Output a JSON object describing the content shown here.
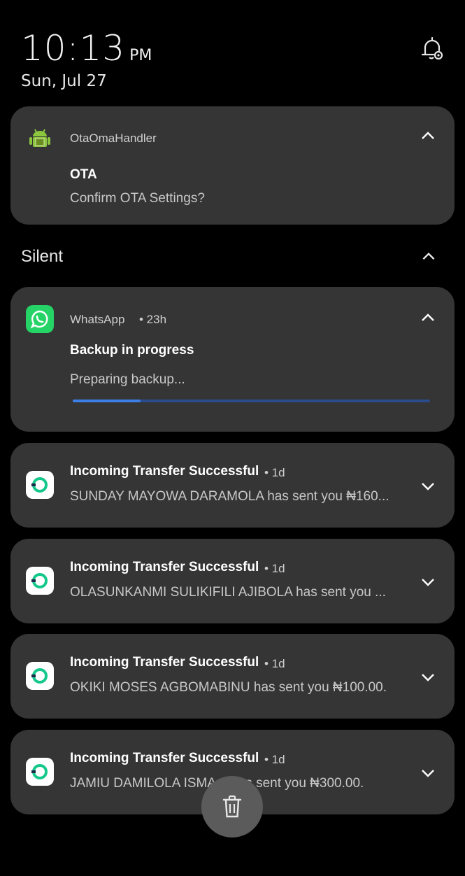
{
  "status": {
    "time": "10:13",
    "ampm": "PM",
    "date": "Sun, Jul 27"
  },
  "ota": {
    "app": "OtaOmaHandler",
    "title": "OTA",
    "body": "Confirm OTA Settings?"
  },
  "section": {
    "label": "Silent"
  },
  "whatsapp": {
    "app": "WhatsApp",
    "time": "• 23h",
    "title": "Backup in progress",
    "body": "Preparing backup...",
    "progress": 0.19,
    "brand_color": "#25d366"
  },
  "transfers": [
    {
      "title": "Incoming Transfer Successful",
      "time": "• 1d",
      "body": "SUNDAY MAYOWA DARAMOLA has sent you ₦160..."
    },
    {
      "title": "Incoming Transfer Successful",
      "time": "• 1d",
      "body": "OLASUNKANMI SULIKIFILI AJIBOLA has sent you ..."
    },
    {
      "title": "Incoming Transfer Successful",
      "time": "• 1d",
      "body": "OKIKI MOSES AGBOMABINU has sent you ₦100.00."
    },
    {
      "title": "Incoming Transfer Successful",
      "time": "• 1d",
      "body": "JAMIU DAMILOLA ISMA... has sent you ₦300.00."
    }
  ],
  "icons": {
    "bell": "notification-settings-icon",
    "ota": "android-icon",
    "whatsapp": "whatsapp-icon",
    "transfer": "opay-icon",
    "trash": "trash-icon"
  }
}
